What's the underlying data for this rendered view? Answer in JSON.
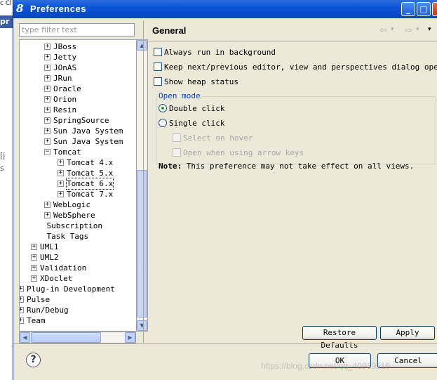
{
  "window": {
    "title": "Preferences",
    "minimize": "_",
    "maximize": "□",
    "close": "x"
  },
  "background": {
    "top_text": "c Cl",
    "bar_text": "pr",
    "frag1": "[j",
    "frag2": "s"
  },
  "filter": {
    "placeholder": "type filter text"
  },
  "tree": [
    {
      "label": "JBoss",
      "toggle": "+",
      "indent": 1
    },
    {
      "label": "Jetty",
      "toggle": "+",
      "indent": 1
    },
    {
      "label": "JOnAS",
      "toggle": "+",
      "indent": 1
    },
    {
      "label": "JRun",
      "toggle": "+",
      "indent": 1
    },
    {
      "label": "Oracle",
      "toggle": "+",
      "indent": 1
    },
    {
      "label": "Orion",
      "toggle": "+",
      "indent": 1
    },
    {
      "label": "Resin",
      "toggle": "+",
      "indent": 1
    },
    {
      "label": "SpringSource",
      "toggle": "+",
      "indent": 1
    },
    {
      "label": "Sun Java System",
      "toggle": "+",
      "indent": 1
    },
    {
      "label": "Sun Java System",
      "toggle": "+",
      "indent": 1
    },
    {
      "label": "Tomcat",
      "toggle": "−",
      "indent": 1
    },
    {
      "label": "Tomcat  4.x",
      "toggle": "+",
      "indent": 2
    },
    {
      "label": "Tomcat  5.x",
      "toggle": "+",
      "indent": 2
    },
    {
      "label": "Tomcat  6.x",
      "toggle": "+",
      "indent": 2,
      "selected": true
    },
    {
      "label": "Tomcat  7.x",
      "toggle": "+",
      "indent": 2
    },
    {
      "label": "WebLogic",
      "toggle": "+",
      "indent": 1
    },
    {
      "label": "WebSphere",
      "toggle": "+",
      "indent": 1
    },
    {
      "label": "Subscription",
      "toggle": "",
      "indent": 0.5
    },
    {
      "label": "Task Tags",
      "toggle": "",
      "indent": 0.5
    },
    {
      "label": "UML1",
      "toggle": "+",
      "indent": 0
    },
    {
      "label": "UML2",
      "toggle": "+",
      "indent": 0
    },
    {
      "label": "Validation",
      "toggle": "+",
      "indent": 0
    },
    {
      "label": "XDoclet",
      "toggle": "+",
      "indent": 0
    },
    {
      "label": "Plug-in Development",
      "toggle": "+",
      "indent": -1
    },
    {
      "label": "Pulse",
      "toggle": "+",
      "indent": -1
    },
    {
      "label": "Run/Debug",
      "toggle": "+",
      "indent": -1
    },
    {
      "label": "Team",
      "toggle": "+",
      "indent": -1
    }
  ],
  "pane": {
    "title": "General",
    "nav_back": "⇦",
    "nav_fwd": "⇨",
    "nav_menu": "▾",
    "options": [
      {
        "label": "Always run in background",
        "checked": false
      },
      {
        "label": "Keep next/previous editor, view and perspectives dialog open",
        "checked": false
      },
      {
        "label": "Show heap status",
        "checked": false
      }
    ],
    "open_mode": {
      "title": "Open mode",
      "double_click": "Double click",
      "single_click": "Single click",
      "selected": "Double click",
      "select_on_hover": "Select on hover",
      "open_arrow_keys": "Open when using arrow keys"
    },
    "note_label": "Note:",
    "note_text": " This preference may not take effect on all views."
  },
  "buttons": {
    "restore_defaults": "Restore Defaults",
    "apply": "Apply",
    "ok": "OK",
    "cancel": "Cancel",
    "help": "?"
  },
  "watermark": "https://blog.csdn.net/qq_40939516"
}
